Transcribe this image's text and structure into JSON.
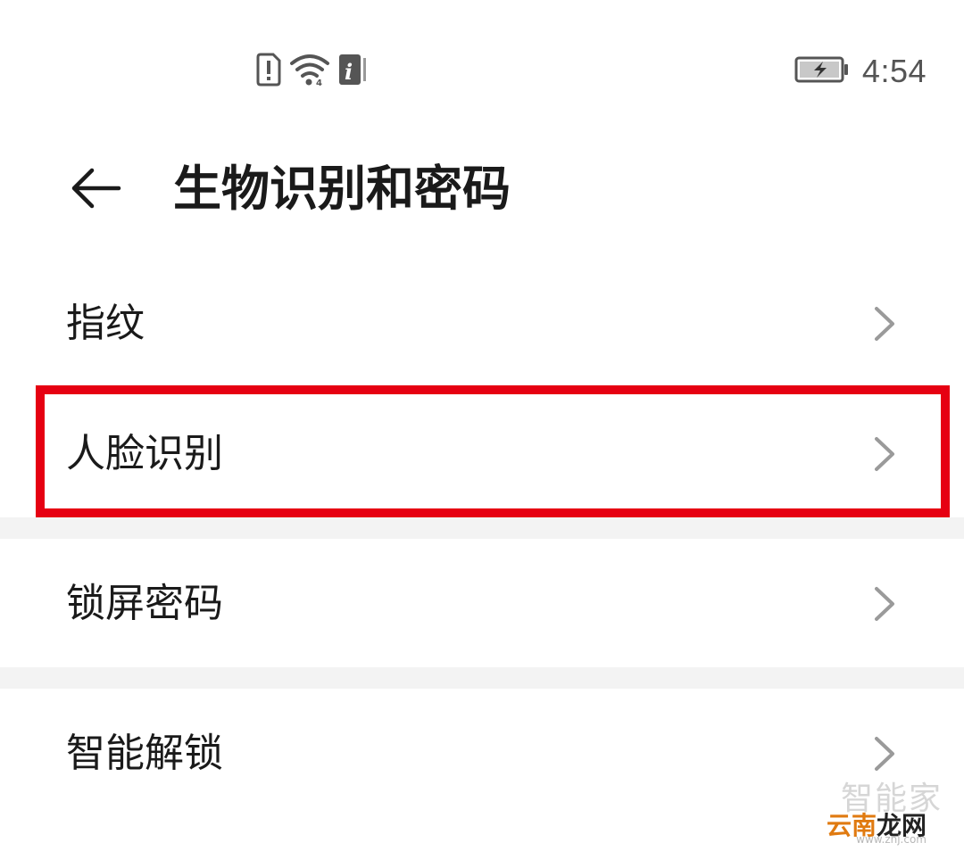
{
  "status_bar": {
    "time": "4:54",
    "icons_left": [
      "sim-alert-icon",
      "wifi-icon",
      "info-icon"
    ],
    "icons_right": [
      "battery-charging-icon"
    ]
  },
  "header": {
    "back_icon": "arrow-left-icon",
    "title": "生物识别和密码"
  },
  "groups": [
    {
      "items": [
        {
          "label": "指纹",
          "icon": "chevron-right-icon"
        },
        {
          "label": "人脸识别",
          "icon": "chevron-right-icon",
          "highlighted": true
        }
      ]
    },
    {
      "items": [
        {
          "label": "锁屏密码",
          "icon": "chevron-right-icon"
        }
      ]
    },
    {
      "items": [
        {
          "label": "智能解锁",
          "icon": "chevron-right-icon"
        }
      ]
    }
  ],
  "colors": {
    "highlight_border": "#e60012",
    "separator": "#f3f3f3",
    "chevron": "#9a9a9a",
    "text": "#1a1a1a"
  },
  "watermark": {
    "line1": "智能家",
    "line2_part1": "云南",
    "line2_part2": "龙网",
    "url": "www.znj.com"
  }
}
